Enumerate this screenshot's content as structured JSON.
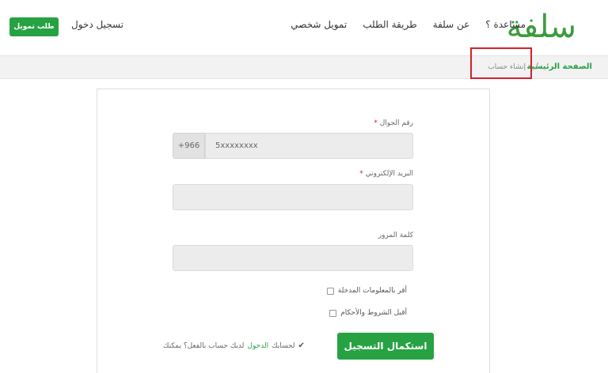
{
  "header": {
    "logo_text": "سلفة",
    "nav": [
      "تمويل شخصي",
      "طريقة الطلب",
      "عن سلفة",
      "مساعدة ؟"
    ],
    "login_label": "تسجيل دخول",
    "apply_label": "طلب تمويل"
  },
  "breadcrumb": {
    "home": "الصفحة الرئيسية",
    "separator": "/",
    "current": "إنشاء حساب"
  },
  "form": {
    "phone_label": "رقم الجوال",
    "phone_prefix": "+966",
    "phone_value": "5xxxxxxxx",
    "email_label": "البريد الإلكتروني",
    "email_value": "",
    "password_label": "كلمة المرور",
    "password_value": "",
    "required_mark": "*",
    "confirm_info_label": "أقر بالمعلومات المدخلة",
    "accept_terms_label": "أقبل الشروط والأحكام",
    "submit_label": "استكمال التسجيل",
    "have_account_text": "لديك حساب بالفعل؟ يمكنك",
    "have_account_link": "الدخول",
    "have_account_suffix": "لحسابك"
  },
  "colors": {
    "brand_green": "#27a243",
    "logo_green": "#3a9c3c",
    "highlight_red": "#d4202a"
  }
}
